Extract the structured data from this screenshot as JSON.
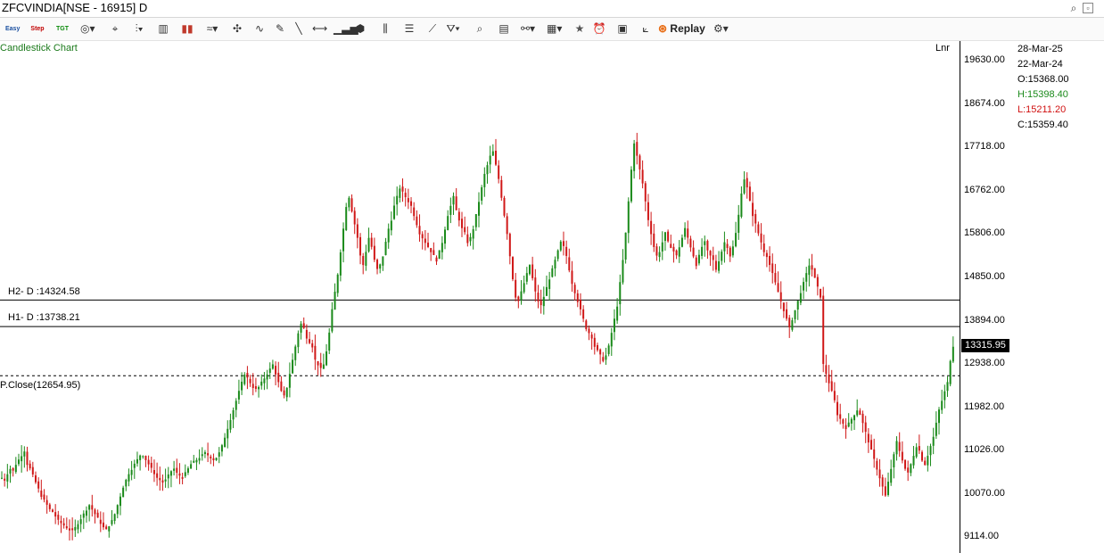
{
  "window": {
    "title": "ZFCVINDIA[NSE - 16915] D",
    "pin_icon": "pin-icon",
    "restore_icon": "restore-icon"
  },
  "toolbar": {
    "icons": [
      "easy-icon",
      "step-icon",
      "tgt-icon",
      "crosshair-icon",
      "pointer-icon",
      "chart-type-icon",
      "bar-chart-icon",
      "candle-icon",
      "indicator-icon",
      "cursor-icon",
      "wave-icon",
      "pencil-icon",
      "line-icon",
      "hline-icon",
      "volume-icon",
      "cube-icon",
      "fib-icon",
      "parallel-icon",
      "ruler-icon",
      "fill-icon",
      "zoom-icon",
      "page-icon",
      "link-icon",
      "layout-icon",
      "star-icon",
      "alarm-icon",
      "save-icon",
      "trend-icon",
      "replay-icon",
      "settings-icon"
    ],
    "easy_label": "Easy",
    "step_label": "Step",
    "tgt_label": "TGT",
    "replay_label": "Replay"
  },
  "chart": {
    "label": "Candlestick Chart",
    "scale_mode": "Lnr",
    "last_price": "13315.95",
    "h2_label": "H2- D :14324.58",
    "h1_label": "H1- D :13738.21",
    "pclose_label": "P.Close(12654.95)"
  },
  "price_axis": [
    "19630.00",
    "18674.00",
    "17718.00",
    "16762.00",
    "15806.00",
    "14850.00",
    "13894.00",
    "12938.00",
    "11982.00",
    "11026.00",
    "10070.00",
    "9114.00"
  ],
  "info": {
    "date1": "28-Mar-25",
    "date2": "22-Mar-24",
    "open": "O:15368.00",
    "high": "H:15398.40",
    "low": "L:15211.20",
    "close": "C:15359.40"
  },
  "chart_data": {
    "type": "line",
    "ylim": [
      9000,
      19800
    ],
    "series": [
      {
        "values": [
          10400,
          10350,
          10500,
          10600,
          10550,
          10700,
          10800,
          10900,
          11000,
          10700,
          10600,
          10450,
          10300,
          10150,
          10000,
          9900,
          9800,
          9700,
          9650,
          9550,
          9450,
          9400,
          9350,
          9300,
          9250,
          9220,
          9300,
          9400,
          9500,
          9600,
          9700,
          9800,
          9700,
          9600,
          9500,
          9400,
          9300,
          9250,
          9350,
          9450,
          9600,
          9800,
          10000,
          10200,
          10350,
          10500,
          10600,
          10700,
          10800,
          10900,
          10900,
          10800,
          10700,
          10600,
          10500,
          10400,
          10350,
          10300,
          10350,
          10450,
          10550,
          10600,
          10500,
          10450,
          10400,
          10500,
          10600,
          10700,
          10750,
          10800,
          10850,
          10900,
          10950,
          10900,
          10850,
          10800,
          10850,
          10950,
          11100,
          11300,
          11500,
          11700,
          11900,
          12100,
          12300,
          12500,
          12700,
          12600,
          12500,
          12400,
          12350,
          12400,
          12500,
          12600,
          12700,
          12800,
          12900,
          12700,
          12500,
          12300,
          12200,
          12400,
          12700,
          13000,
          13300,
          13600,
          13800,
          13700,
          13500,
          13400,
          13300,
          13000,
          12900,
          12800,
          12900,
          13200,
          13600,
          14100,
          14500,
          14900,
          15400,
          15900,
          16400,
          16600,
          16300,
          16000,
          15700,
          15300,
          15100,
          15400,
          15700,
          15500,
          15200,
          15000,
          15100,
          15300,
          15600,
          15900,
          16100,
          16400,
          16600,
          16800,
          16700,
          16600,
          16500,
          16400,
          16200,
          16000,
          15800,
          15700,
          15600,
          15500,
          15400,
          15300,
          15200,
          15400,
          15600,
          15900,
          16200,
          16400,
          16600,
          16300,
          16100,
          15900,
          15800,
          15600,
          15700,
          15900,
          16200,
          16500,
          16800,
          17100,
          17300,
          17500,
          17600,
          17300,
          17000,
          16600,
          16200,
          15800,
          15300,
          14800,
          14400,
          14300,
          14500,
          14700,
          14900,
          15100,
          14800,
          14500,
          14300,
          14200,
          14400,
          14600,
          14800,
          15000,
          15200,
          15400,
          15600,
          15500,
          15300,
          15000,
          14700,
          14500,
          14300,
          14100,
          13900,
          13700,
          13600,
          13500,
          13300,
          13200,
          13100,
          13000,
          13100,
          13300,
          13600,
          13900,
          14200,
          14700,
          15200,
          15800,
          16500,
          17200,
          17800,
          17500,
          17200,
          16900,
          16500,
          16100,
          15800,
          15500,
          15300,
          15400,
          15600,
          15800,
          15600,
          15500,
          15400,
          15300,
          15500,
          15700,
          15900,
          15700,
          15500,
          15300,
          15100,
          15300,
          15500,
          15600,
          15400,
          15300,
          15200,
          15000,
          15200,
          15400,
          15600,
          15500,
          15300,
          15500,
          15800,
          16200,
          16700,
          17000,
          16800,
          16500,
          16200,
          16000,
          15800,
          15600,
          15400,
          15300,
          15100,
          14900,
          14700,
          14500,
          14300,
          14100,
          13900,
          13700,
          13900,
          14100,
          14300,
          14500,
          14700,
          14900,
          15100,
          15000,
          14800,
          14600,
          14400,
          12900,
          12700,
          12500,
          12300,
          12100,
          11800,
          11700,
          11600,
          11500,
          11600,
          11700,
          11800,
          11900,
          11800,
          11600,
          11400,
          11200,
          11000,
          10800,
          10600,
          10400,
          10200,
          10000,
          10300,
          10600,
          10900,
          11200,
          11000,
          10800,
          10600,
          10500,
          10700,
          10900,
          11100,
          11000,
          10800,
          10700,
          10900,
          11100,
          11300,
          11600,
          11900,
          12100,
          12300,
          12500,
          13000,
          13316
        ]
      }
    ]
  }
}
